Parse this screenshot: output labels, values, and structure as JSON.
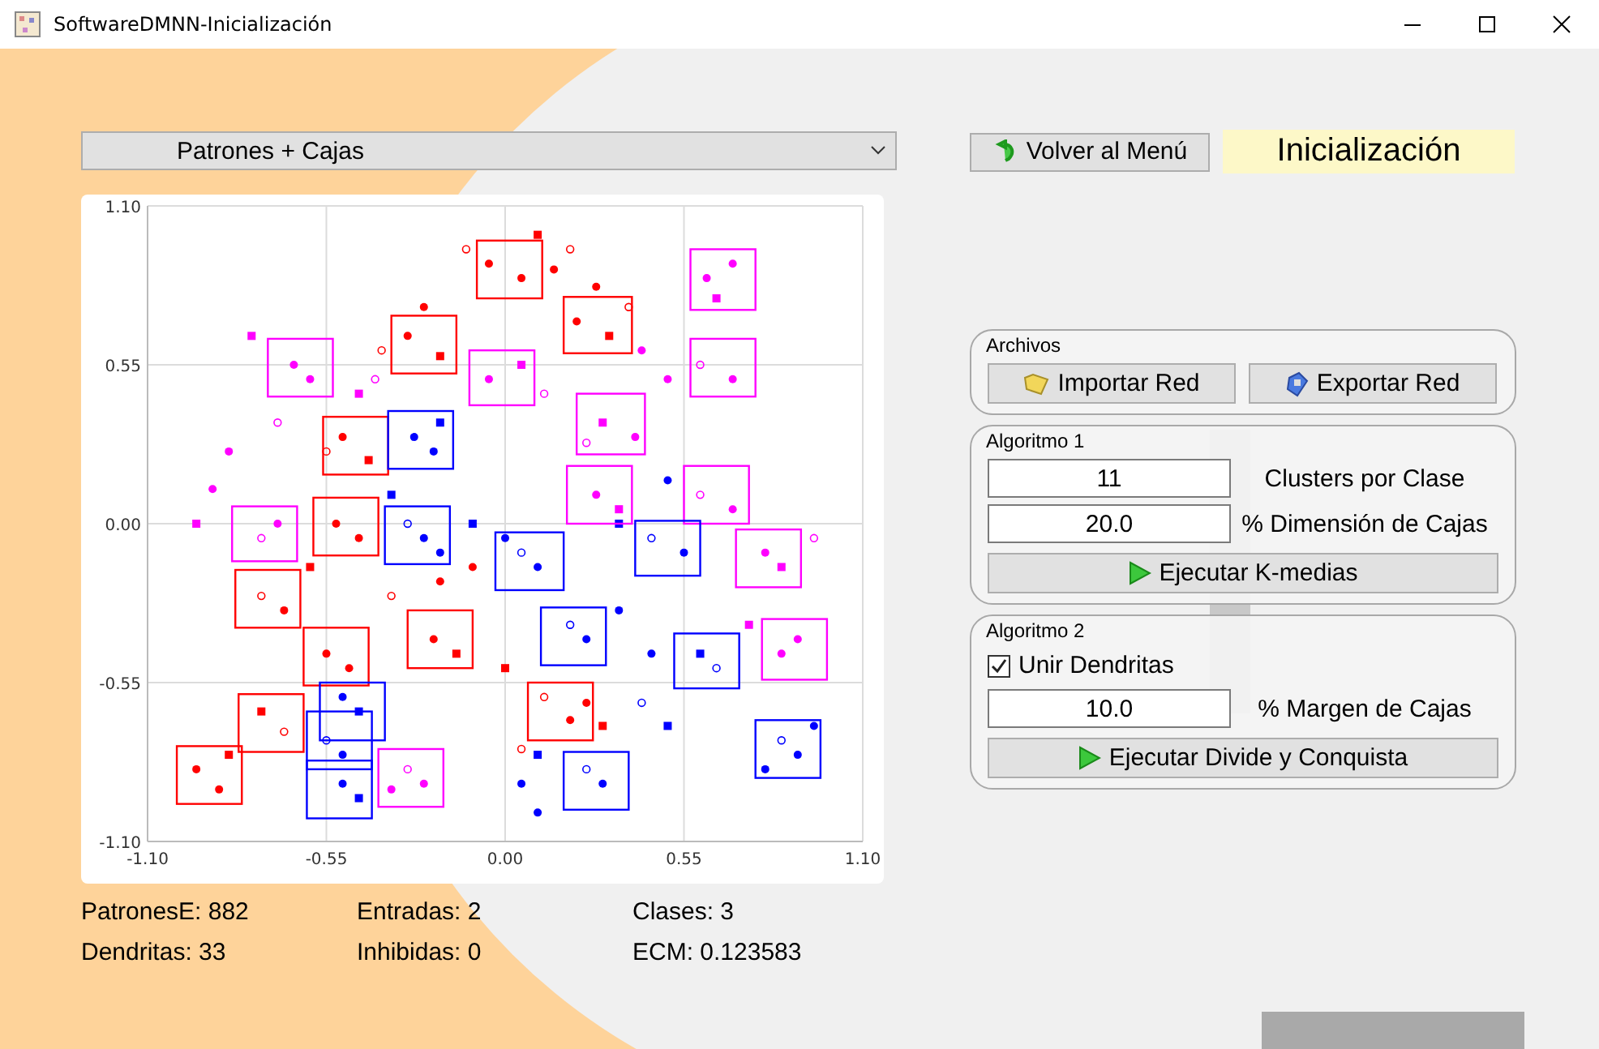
{
  "window": {
    "title": "SoftwareDMNN-Inicialización"
  },
  "view_select": {
    "value": "Patrones + Cajas"
  },
  "plot": {
    "chart_data": {
      "type": "scatter",
      "grid": true,
      "xlim": [
        -1.1,
        1.1
      ],
      "ylim": [
        -1.1,
        1.1
      ],
      "xticks": [
        {
          "value": -1.1,
          "label": "-1.10"
        },
        {
          "value": -0.55,
          "label": "-0.55"
        },
        {
          "value": 0,
          "label": "0.00"
        },
        {
          "value": 0.55,
          "label": "0.55"
        },
        {
          "value": 1.1,
          "label": "1.10"
        }
      ],
      "yticks": [
        {
          "value": -1.1,
          "label": "-1.10"
        },
        {
          "value": -0.55,
          "label": "-0.55"
        },
        {
          "value": 0,
          "label": "0.00"
        },
        {
          "value": 0.55,
          "label": "0.55"
        },
        {
          "value": 1.1,
          "label": "1.10"
        }
      ],
      "series": [
        {
          "color": "#ff0000",
          "x": [
            -0.05,
            0.05,
            0.1,
            -0.12,
            0.15,
            0.22,
            0.32,
            0.38,
            0.28,
            -0.3,
            -0.2,
            -0.38,
            -0.25,
            -0.5,
            -0.42,
            -0.55,
            -0.52,
            -0.45,
            -0.6,
            -0.75,
            -0.68,
            -0.22,
            -0.15,
            -0.35,
            -0.55,
            -0.48,
            -0.75,
            -0.68,
            -0.95,
            -0.88,
            -0.85,
            0.12,
            0.2,
            0.25,
            0.0,
            0.05,
            -0.1,
            -0.2,
            0.3,
            0.2
          ],
          "values": [
            0.9,
            0.85,
            1.0,
            0.95,
            0.88,
            0.7,
            0.65,
            0.75,
            0.82,
            0.65,
            0.58,
            0.6,
            0.75,
            0.3,
            0.22,
            0.25,
            0.0,
            -0.05,
            -0.15,
            -0.25,
            -0.3,
            -0.4,
            -0.45,
            -0.25,
            -0.45,
            -0.5,
            -0.65,
            -0.72,
            -0.85,
            -0.92,
            -0.8,
            -0.6,
            -0.68,
            -0.62,
            -0.5,
            -0.78,
            -0.15,
            -0.2,
            -0.7,
            0.95
          ]
        },
        {
          "color": "#ff00ff",
          "x": [
            -0.65,
            -0.6,
            -0.78,
            -0.7,
            -0.85,
            -0.9,
            -0.95,
            -0.75,
            -0.7,
            -0.05,
            0.05,
            0.12,
            0.62,
            0.7,
            0.65,
            0.6,
            0.7,
            0.5,
            0.3,
            0.25,
            0.4,
            0.28,
            0.35,
            0.6,
            0.7,
            0.8,
            0.85,
            0.95,
            0.85,
            0.9,
            0.75,
            -0.3,
            -0.25,
            -0.35,
            -0.45,
            -0.4,
            0.42
          ],
          "values": [
            0.55,
            0.5,
            0.65,
            0.35,
            0.25,
            0.12,
            0.0,
            -0.05,
            0.0,
            0.5,
            0.55,
            0.45,
            0.85,
            0.9,
            0.78,
            0.55,
            0.5,
            0.5,
            0.35,
            0.28,
            0.3,
            0.1,
            0.05,
            0.1,
            0.05,
            -0.1,
            -0.15,
            -0.05,
            -0.45,
            -0.4,
            -0.35,
            -0.85,
            -0.9,
            -0.92,
            0.45,
            0.5,
            0.6
          ]
        },
        {
          "color": "#0000ff",
          "x": [
            -0.28,
            -0.22,
            -0.2,
            -0.3,
            -0.25,
            -0.2,
            -0.35,
            0.05,
            0.1,
            0.0,
            -0.1,
            0.45,
            0.55,
            0.5,
            0.35,
            0.2,
            0.25,
            0.35,
            0.6,
            0.65,
            0.45,
            -0.5,
            -0.45,
            -0.55,
            -0.5,
            -0.5,
            -0.45,
            0.25,
            0.3,
            0.05,
            0.1,
            0.85,
            0.9,
            0.8,
            0.5,
            0.42,
            0.95,
            0.1
          ],
          "values": [
            0.3,
            0.25,
            0.35,
            0.0,
            -0.05,
            -0.1,
            0.1,
            -0.1,
            -0.15,
            -0.05,
            0.0,
            -0.05,
            -0.1,
            0.15,
            0.0,
            -0.35,
            -0.4,
            -0.3,
            -0.45,
            -0.5,
            -0.45,
            -0.6,
            -0.65,
            -0.75,
            -0.8,
            -0.9,
            -0.95,
            -0.85,
            -0.9,
            -0.9,
            -0.8,
            -0.75,
            -0.8,
            -0.85,
            -0.7,
            -0.62,
            -0.7,
            -1.0
          ]
        }
      ]
    },
    "dendrite_boxes": [
      {
        "color": "#ff0000"
      },
      {
        "color": "#ff0000"
      },
      {
        "color": "#ff0000"
      },
      {
        "color": "#ff0000"
      },
      {
        "color": "#ff0000"
      },
      {
        "color": "#ff0000"
      },
      {
        "color": "#ff0000"
      },
      {
        "color": "#ff0000"
      },
      {
        "color": "#ff0000"
      },
      {
        "color": "#ff0000"
      },
      {
        "color": "#ff0000"
      },
      {
        "color": "#ff00ff"
      },
      {
        "color": "#ff00ff"
      },
      {
        "color": "#ff00ff"
      },
      {
        "color": "#ff00ff"
      },
      {
        "color": "#ff00ff"
      },
      {
        "color": "#ff00ff"
      },
      {
        "color": "#ff00ff"
      },
      {
        "color": "#ff00ff"
      },
      {
        "color": "#ff00ff"
      },
      {
        "color": "#ff00ff"
      },
      {
        "color": "#ff00ff"
      },
      {
        "color": "#0000ff"
      },
      {
        "color": "#0000ff"
      },
      {
        "color": "#0000ff"
      },
      {
        "color": "#0000ff"
      },
      {
        "color": "#0000ff"
      },
      {
        "color": "#0000ff"
      },
      {
        "color": "#0000ff"
      },
      {
        "color": "#0000ff"
      },
      {
        "color": "#0000ff"
      },
      {
        "color": "#0000ff"
      },
      {
        "color": "#0000ff"
      }
    ]
  },
  "stats": [
    "PatronesE: 882",
    "Entradas: 2",
    "Clases: 3",
    "Dendritas: 33",
    "Inhibidas: 0",
    "ECM: 0.123583"
  ],
  "back_button": "Volver al Menú",
  "mode_label": "Inicialización",
  "archivos": {
    "title": "Archivos",
    "import_button": "Importar Red",
    "export_button": "Exportar Red"
  },
  "algoritmo1": {
    "title": "Algoritmo 1",
    "clusters": {
      "value": "11",
      "label": "Clusters por Clase"
    },
    "dimension": {
      "value": "20.0",
      "label": "% Dimensión de Cajas"
    },
    "run_button": "Ejecutar K-medias"
  },
  "algoritmo2": {
    "title": "Algoritmo 2",
    "merge": {
      "label": "Unir Dendritas",
      "checked": true
    },
    "margin": {
      "value": "10.0",
      "label": "% Margen de Cajas"
    },
    "run_button": "Ejecutar Divide y Conquista"
  }
}
